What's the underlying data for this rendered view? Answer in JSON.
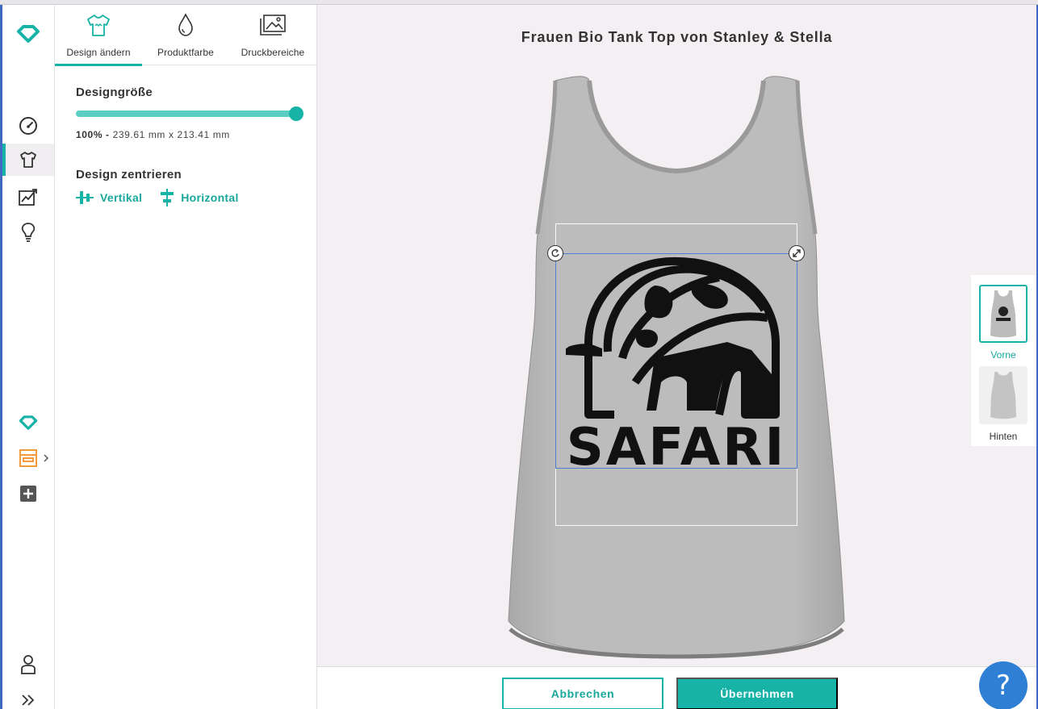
{
  "product": {
    "title": "Frauen Bio Tank Top von Stanley & Stella"
  },
  "tabs": [
    {
      "label": "Design ändern",
      "icon": "tshirt-icon",
      "active": true
    },
    {
      "label": "Produktfarbe",
      "icon": "droplet-icon",
      "active": false
    },
    {
      "label": "Druckbereiche",
      "icon": "images-icon",
      "active": false
    }
  ],
  "design_size": {
    "title": "Designgröße",
    "percent_label": "100%",
    "separator": "-",
    "dimensions": "239.61 mm x 213.41 mm",
    "slider_value_percent": 100
  },
  "center": {
    "title": "Design zentrieren",
    "vertical_label": "Vertikal",
    "horizontal_label": "Horizontal"
  },
  "design": {
    "text": "SAFARI"
  },
  "views": [
    {
      "label": "Vorne",
      "active": true
    },
    {
      "label": "Hinten",
      "active": false
    }
  ],
  "footer": {
    "cancel_label": "Abbrechen",
    "apply_label": "Übernehmen"
  },
  "help": {
    "label": "?"
  },
  "colors": {
    "accent": "#17b3a6",
    "shirt": "#b9b9b9",
    "selection": "#4f7fd1",
    "help": "#2f7fd4"
  }
}
